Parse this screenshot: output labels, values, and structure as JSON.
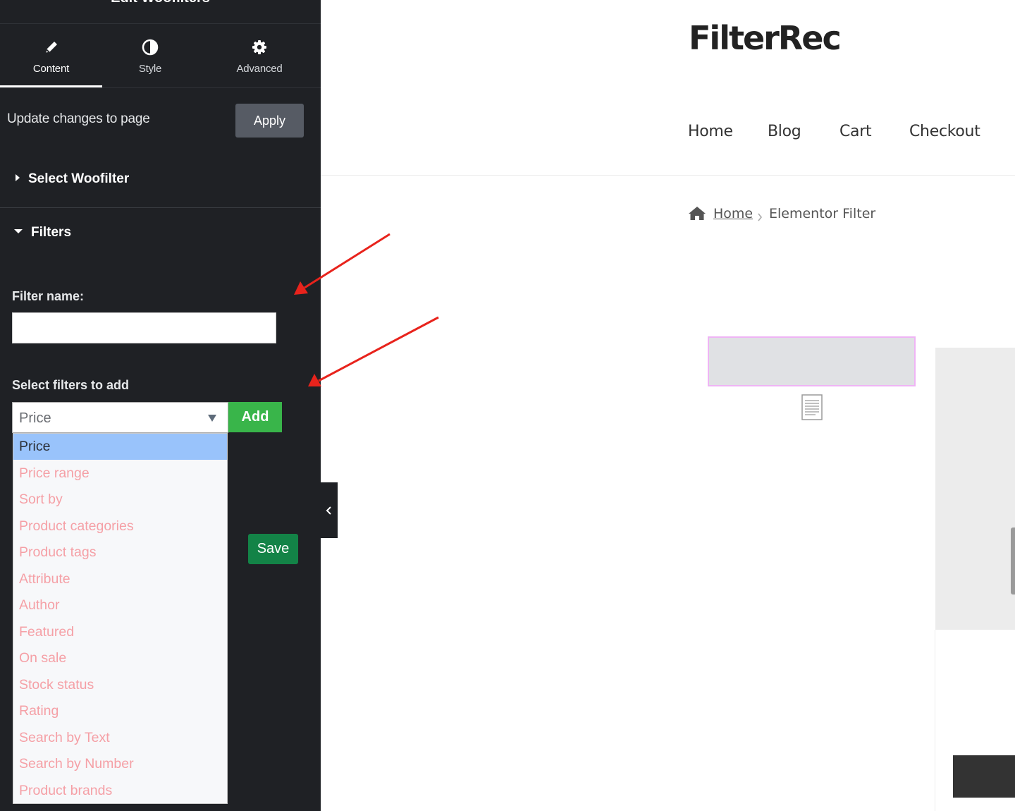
{
  "panel": {
    "title": "Edit Woofilters",
    "tabs": [
      {
        "label": "Content",
        "icon": "pencil-icon",
        "active": true
      },
      {
        "label": "Style",
        "icon": "contrast-icon",
        "active": false
      },
      {
        "label": "Advanced",
        "icon": "gear-icon",
        "active": false
      }
    ],
    "update_label": "Update changes to page",
    "apply_label": "Apply",
    "sections": {
      "select_woofilter": "Select Woofilter",
      "filters": "Filters"
    },
    "filter_name_label": "Filter name:",
    "filter_name_value": "",
    "select_filters_label": "Select filters to add",
    "filter_select_value": "Price",
    "add_label": "Add",
    "save_label": "Save",
    "dropdown_options": [
      "Price",
      "Price range",
      "Sort by",
      "Product categories",
      "Product tags",
      "Attribute",
      "Author",
      "Featured",
      "On sale",
      "Stock status",
      "Rating",
      "Search by Text",
      "Search by Number",
      "Product brands"
    ],
    "dropdown_selected": "Price"
  },
  "site": {
    "title": "FilterRec",
    "nav": [
      "Home",
      "Blog",
      "Cart",
      "Checkout"
    ],
    "breadcrumb": {
      "home": "Home",
      "current": "Elementor Filter"
    }
  },
  "colors": {
    "panel_bg": "#1f2125",
    "apply_bg": "#565b64",
    "add_bg": "#39b54a",
    "save_bg": "#138347",
    "dropdown_selected_bg": "#99c3fb",
    "dropdown_item_text": "#f5a0a6",
    "arrow": "#e8231c",
    "placeholder_border": "#efb4f5"
  }
}
